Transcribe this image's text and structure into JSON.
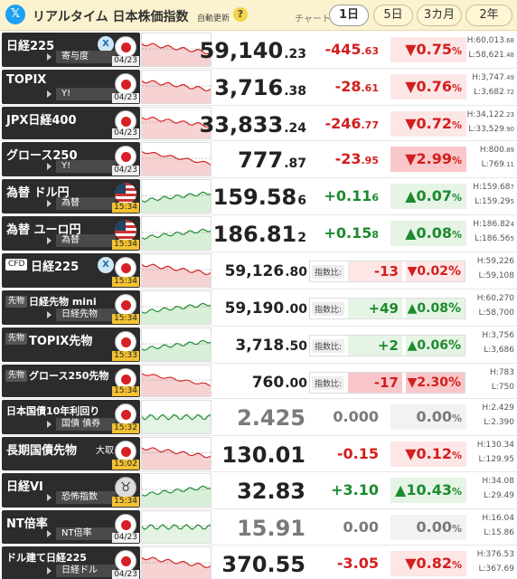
{
  "header": {
    "x_icon": "x-logo-icon",
    "title": "リアルタイム 日本株価指数",
    "auto_update": "自動更新",
    "help": "?",
    "chart_label": "チャート:",
    "periods": [
      "1日",
      "5日",
      "3カ月",
      "2年"
    ],
    "active_period": "1日"
  },
  "colors": {
    "up": "#1c8a2e",
    "down": "#d21f1f",
    "flat": "#7a7a7a",
    "header_bg": "#fbf3cf"
  },
  "rows": [
    {
      "name": "日経225",
      "sub": "寄与度",
      "x": "X",
      "time": "04/23",
      "flag": "japan-flag-icon",
      "price_int": "59,140",
      "price_dec": ".23",
      "chg_int": "-445",
      "chg_dec": ".63",
      "pct_int": "▼0.75",
      "pct_dec": "%",
      "high": "H:60,013",
      "high_dec": ".68",
      "low": "L:58,621",
      "low_dec": ".48",
      "trend": "down"
    },
    {
      "name": "TOPIX",
      "sub": "Y!",
      "time": "04/23",
      "flag": "japan-flag-icon",
      "price_int": "3,716",
      "price_dec": ".38",
      "chg_int": "-28",
      "chg_dec": ".61",
      "pct_int": "▼0.76",
      "pct_dec": "%",
      "high": "H:3,747",
      "high_dec": ".49",
      "low": "L:3,682",
      "low_dec": ".72",
      "trend": "down"
    },
    {
      "name": "JPX日経400",
      "time": "04/23",
      "flag": "japan-flag-icon",
      "price_int": "33,833",
      "price_dec": ".24",
      "chg_int": "-246",
      "chg_dec": ".77",
      "pct_int": "▼0.72",
      "pct_dec": "%",
      "high": "H:34,122",
      "high_dec": ".23",
      "low": "L:33,529",
      "low_dec": ".90",
      "trend": "down"
    },
    {
      "name": "グロース250",
      "sub": "Y!",
      "time": "04/23",
      "flag": "japan-flag-icon",
      "price_int": "777",
      "price_dec": ".87",
      "chg_int": "-23",
      "chg_dec": ".95",
      "pct_int": "▼2.99",
      "pct_dec": "%",
      "high": "H:800",
      "high_dec": ".89",
      "low": "L:769",
      "low_dec": ".11",
      "trend": "down2"
    },
    {
      "name": "為替 ドル円",
      "sub": "為替",
      "time": "15:34",
      "flag": "us-flag-icon",
      "price_int": "159.58",
      "price_dec": "6",
      "chg_int": "+0.11",
      "chg_dec": "6",
      "pct_int": "▲0.07",
      "pct_dec": "%",
      "high": "H:159.68",
      "high_dec": "7",
      "low": "L:159.29",
      "low_dec": "5",
      "trend": "up"
    },
    {
      "name": "為替 ユーロ円",
      "sub": "為替",
      "time": "15:34",
      "flag": "eu-flag-icon",
      "price_int": "186.81",
      "price_dec": "2",
      "chg_int": "+0.15",
      "chg_dec": "8",
      "pct_int": "▲0.08",
      "pct_dec": "%",
      "high": "H:186.82",
      "high_dec": "4",
      "low": "L:186.56",
      "low_dec": "5",
      "trend": "up"
    },
    {
      "name": "日経225",
      "cfd": "CFD",
      "x": "X",
      "time": "15:34",
      "flag": "japan-flag-icon",
      "price_int": "59,126",
      "price_dec": ".80",
      "idx_label": "指数比:",
      "idx_val": "-13",
      "idx_pct": "▼0.02%",
      "high": "H:59,226",
      "low": "L:59,108",
      "trend": "down"
    },
    {
      "name": "日経先物 mini",
      "fut": "先物",
      "sub": "日経先物",
      "time": "15:34",
      "flag": "japan-flag-icon",
      "price_int": "59,190",
      "price_dec": ".00",
      "idx_label": "指数比:",
      "idx_val": "+49",
      "idx_pct": "▲0.08%",
      "high": "H:60,270",
      "low": "L:58,700",
      "trend": "up"
    },
    {
      "name": "TOPIX先物",
      "fut": "先物",
      "time": "15:33",
      "flag": "japan-flag-icon",
      "price_int": "3,718",
      "price_dec": ".50",
      "idx_label": "指数比:",
      "idx_val": "+2",
      "idx_pct": "▲0.06%",
      "high": "H:3,756",
      "low": "L:3,686",
      "trend": "up"
    },
    {
      "name": "グロース250先物",
      "fut": "先物",
      "time": "15:34",
      "flag": "japan-flag-icon",
      "price_int": "760",
      "price_dec": ".00",
      "idx_label": "指数比:",
      "idx_val": "-17",
      "idx_pct": "▼2.30%",
      "high": "H:783",
      "low": "L:750",
      "trend": "down2"
    },
    {
      "name": "日本国債10年利回り",
      "sub": "国債 債券",
      "time": "15:32",
      "flag": "japan-flag-icon",
      "price_int": "2.425",
      "price_dec": "",
      "chg_int": "0.000",
      "chg_dec": "",
      "pct_int": "0.00",
      "pct_dec": "%",
      "high": "H:2.429",
      "low": "L:2.390",
      "trend": "flat"
    },
    {
      "name": "長期国債先物",
      "tag": "大取",
      "time": "15:02",
      "flag": "japan-flag-icon",
      "price_int": "130.01",
      "price_dec": "",
      "chg_int": "-0.15",
      "chg_dec": "",
      "pct_int": "▼0.12",
      "pct_dec": "%",
      "high": "H:130.34",
      "low": "L:129.95",
      "trend": "down"
    },
    {
      "name": "日経VI",
      "sub": "恐怖指数",
      "time": "15:34",
      "flag": "bull-icon",
      "price_int": "32.83",
      "price_dec": "",
      "chg_int": "+3.10",
      "chg_dec": "",
      "pct_int": "▲10.43",
      "pct_dec": "%",
      "high": "H:34.08",
      "low": "L:29.49",
      "trend": "up"
    },
    {
      "name": "NT倍率",
      "sub": "NT倍率",
      "time": "04/23",
      "flag": "japan-flag-icon",
      "price_int": "15.91",
      "price_dec": "",
      "chg_int": "0.00",
      "chg_dec": "",
      "pct_int": "0.00",
      "pct_dec": "%",
      "high": "H:16.04",
      "low": "L:15.86",
      "trend": "flat"
    },
    {
      "name": "ドル建て日経225",
      "sub": "日経ドル",
      "time": "04/23",
      "flag": "japan-flag-icon",
      "price_int": "370.55",
      "price_dec": "",
      "chg_int": "-3.05",
      "chg_dec": "",
      "pct_int": "▼0.82",
      "pct_dec": "%",
      "high": "H:376.53",
      "low": "L:367.69",
      "trend": "down"
    }
  ]
}
